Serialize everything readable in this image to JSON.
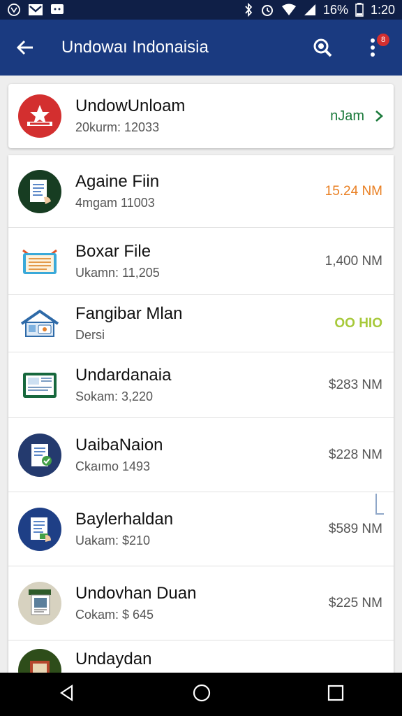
{
  "status_bar": {
    "battery": "16%",
    "time": "1:20",
    "icons": [
      "circle-phone-icon",
      "gmail-icon",
      "message-icon",
      "bluetooth-icon",
      "alarm-icon",
      "wifi-icon",
      "signal-icon",
      "battery-icon"
    ]
  },
  "app_bar": {
    "title": "Undowaı Indonaisia",
    "badge": "8",
    "icons": [
      "back-arrow-icon",
      "search-icon",
      "more-vert-icon"
    ]
  },
  "top_card": {
    "title": "UndowUnloam",
    "subtitle": "20kurm: 12033",
    "action": "nJam",
    "colors": {
      "action": "#1b7a3b",
      "avatar": "#d32f2f"
    }
  },
  "list": [
    {
      "title": "Againe Fiin",
      "subtitle": "4mgam 11003",
      "value": "15.24 NM",
      "value_style": "orange",
      "avatar": "document-hand-icon",
      "avatar_bg": "#173d22"
    },
    {
      "title": "Boxar File",
      "subtitle": "Ukamn: 11,205",
      "value": "1,400 NM",
      "value_style": "normal",
      "avatar": "monitor-file-icon",
      "avatar_bg": "#ffffff"
    },
    {
      "title": "Fangibar Mlan",
      "subtitle": "Dersi",
      "value": "OO HIO",
      "value_style": "lime",
      "avatar": "house-icon",
      "avatar_bg": "#ffffff"
    },
    {
      "title": "Undardanaia",
      "subtitle": "Sokam: 3,220",
      "value": "$283 NM",
      "value_style": "normal",
      "avatar": "tablet-icon",
      "avatar_bg": "#ffffff"
    },
    {
      "title": "UaibaNaion",
      "subtitle": "Ckaımo 1493",
      "value": "$228 NM",
      "value_style": "normal",
      "avatar": "document-check-icon",
      "avatar_bg": "#243a6e"
    },
    {
      "title": "Baylerhaldan",
      "subtitle": "Uakam: $210",
      "value": "$589 NM",
      "value_style": "normal",
      "avatar": "document-hand-icon",
      "avatar_bg": "#1e3f86"
    },
    {
      "title": "Undovhan Duan",
      "subtitle": "Cokam: $ 645",
      "value": "$225 NM",
      "value_style": "normal",
      "avatar": "poster-icon",
      "avatar_bg": "#d7d2c0"
    },
    {
      "title": "Undaydan",
      "subtitle": "",
      "value": "",
      "value_style": "normal",
      "avatar": "framed-picture-icon",
      "avatar_bg": "#2e4d1a"
    }
  ],
  "nav": {
    "icons": [
      "back-triangle-icon",
      "home-circle-icon",
      "recents-square-icon"
    ]
  }
}
